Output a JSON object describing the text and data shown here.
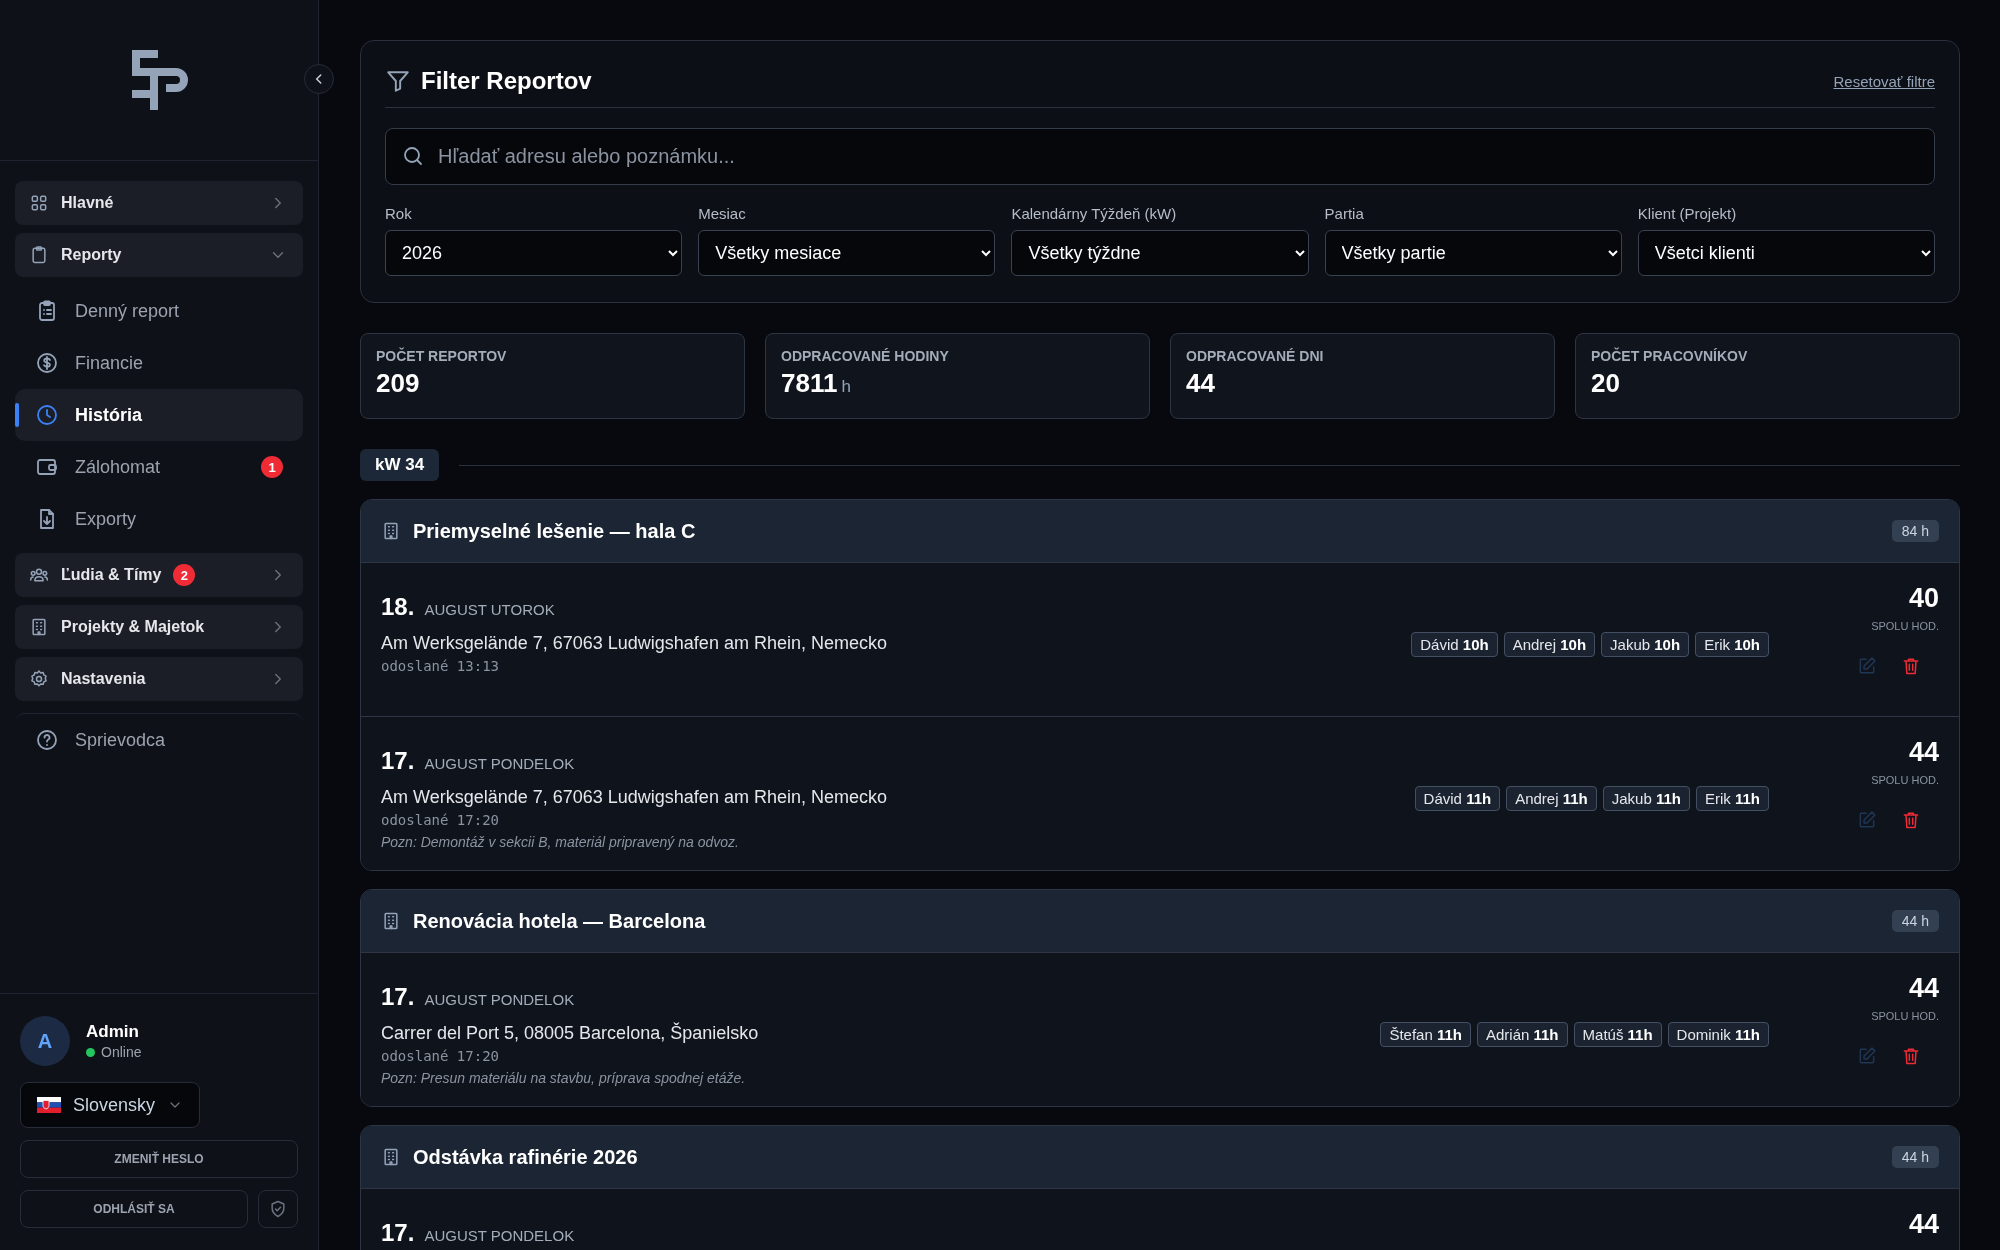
{
  "sidebar": {
    "nav": [
      {
        "label": "Hlavné",
        "kind": "group",
        "expanded": false,
        "selected": false
      },
      {
        "label": "Reporty",
        "kind": "group",
        "expanded": true,
        "selected": false,
        "children": [
          {
            "label": "Denný report",
            "kind": "sub",
            "selected": false
          },
          {
            "label": "Financie",
            "kind": "sub",
            "selected": false
          },
          {
            "label": "História",
            "kind": "sub",
            "selected": true
          },
          {
            "label": "Zálohomat",
            "kind": "sub",
            "selected": false,
            "badge": "1"
          },
          {
            "label": "Exporty",
            "kind": "sub",
            "selected": false
          }
        ]
      },
      {
        "label": "Ľudia & Tímy",
        "kind": "group",
        "expanded": false,
        "selected": false,
        "badge": "2"
      },
      {
        "label": "Projekty & Majetok",
        "kind": "group",
        "expanded": false,
        "selected": false
      },
      {
        "label": "Nastavenia",
        "kind": "group",
        "expanded": false,
        "selected": false
      },
      {
        "label": "Sprievodca",
        "kind": "link",
        "selected": false
      }
    ],
    "user": {
      "initial": "A",
      "name": "Admin",
      "status": "Online",
      "online": true
    },
    "language": "Slovensky",
    "buttons": [
      "ZMENIŤ HESLO",
      "ODHLÁSIŤ SA"
    ]
  },
  "filter": {
    "title": "Filter Reportov",
    "reset": "Resetovať filtre",
    "search": {
      "placeholder": "Hľadať adresu alebo poznámku..."
    },
    "selects": [
      {
        "label": "Rok",
        "value": "2026"
      },
      {
        "label": "Mesiac",
        "value": "Všetky mesiace"
      },
      {
        "label": "Kalendárny Týždeň (kW)",
        "value": "Všetky týždne"
      },
      {
        "label": "Partia",
        "value": "Všetky partie"
      },
      {
        "label": "Klient (Projekt)",
        "value": "Všetci klienti"
      }
    ]
  },
  "stats": [
    {
      "label": "POČET REPORTOV",
      "value": "209"
    },
    {
      "label": "ODPRACOVANÉ HODINY",
      "value": "7811",
      "unit": "h"
    },
    {
      "label": "ODPRACOVANÉ DNI",
      "value": "44"
    },
    {
      "label": "POČET PRACOVNÍKOV",
      "value": "20"
    }
  ],
  "week": "kW 34",
  "groups": [
    {
      "title": "Priemyselné lešenie — hala C",
      "hours": "84 h",
      "reports": [
        {
          "day": "18.",
          "weekday": "AUGUST UTOROK",
          "address": "Am Werksgelände 7, 67063 Ludwigshafen am Rhein, Nemecko",
          "sent": "odoslané 13:13",
          "workers": [
            {
              "name": "Dávid",
              "hours": "10h"
            },
            {
              "name": "Andrej",
              "hours": "10h"
            },
            {
              "name": "Jakub",
              "hours": "10h"
            },
            {
              "name": "Erik",
              "hours": "10h"
            }
          ],
          "total": "40",
          "total_label": "SPOLU HOD."
        },
        {
          "day": "17.",
          "weekday": "AUGUST PONDELOK",
          "address": "Am Werksgelände 7, 67063 Ludwigshafen am Rhein, Nemecko",
          "sent": "odoslané 17:20",
          "note": "Pozn: Demontáž v sekcii B, materiál pripravený na odvoz.",
          "workers": [
            {
              "name": "Dávid",
              "hours": "11h"
            },
            {
              "name": "Andrej",
              "hours": "11h"
            },
            {
              "name": "Jakub",
              "hours": "11h"
            },
            {
              "name": "Erik",
              "hours": "11h"
            }
          ],
          "total": "44",
          "total_label": "SPOLU HOD."
        }
      ]
    },
    {
      "title": "Renovácia hotela — Barcelona",
      "hours": "44 h",
      "reports": [
        {
          "day": "17.",
          "weekday": "AUGUST PONDELOK",
          "address": "Carrer del Port 5, 08005 Barcelona, Španielsko",
          "sent": "odoslané 17:20",
          "note": "Pozn: Presun materiálu na stavbu, príprava spodnej etáže.",
          "workers": [
            {
              "name": "Štefan",
              "hours": "11h"
            },
            {
              "name": "Adrián",
              "hours": "11h"
            },
            {
              "name": "Matúš",
              "hours": "11h"
            },
            {
              "name": "Dominik",
              "hours": "11h"
            }
          ],
          "total": "44",
          "total_label": "SPOLU HOD."
        }
      ]
    },
    {
      "title": "Odstávka rafinérie 2026",
      "hours": "44 h",
      "reports": [
        {
          "day": "17.",
          "weekday": "AUGUST PONDELOK",
          "total": "44"
        }
      ]
    }
  ]
}
